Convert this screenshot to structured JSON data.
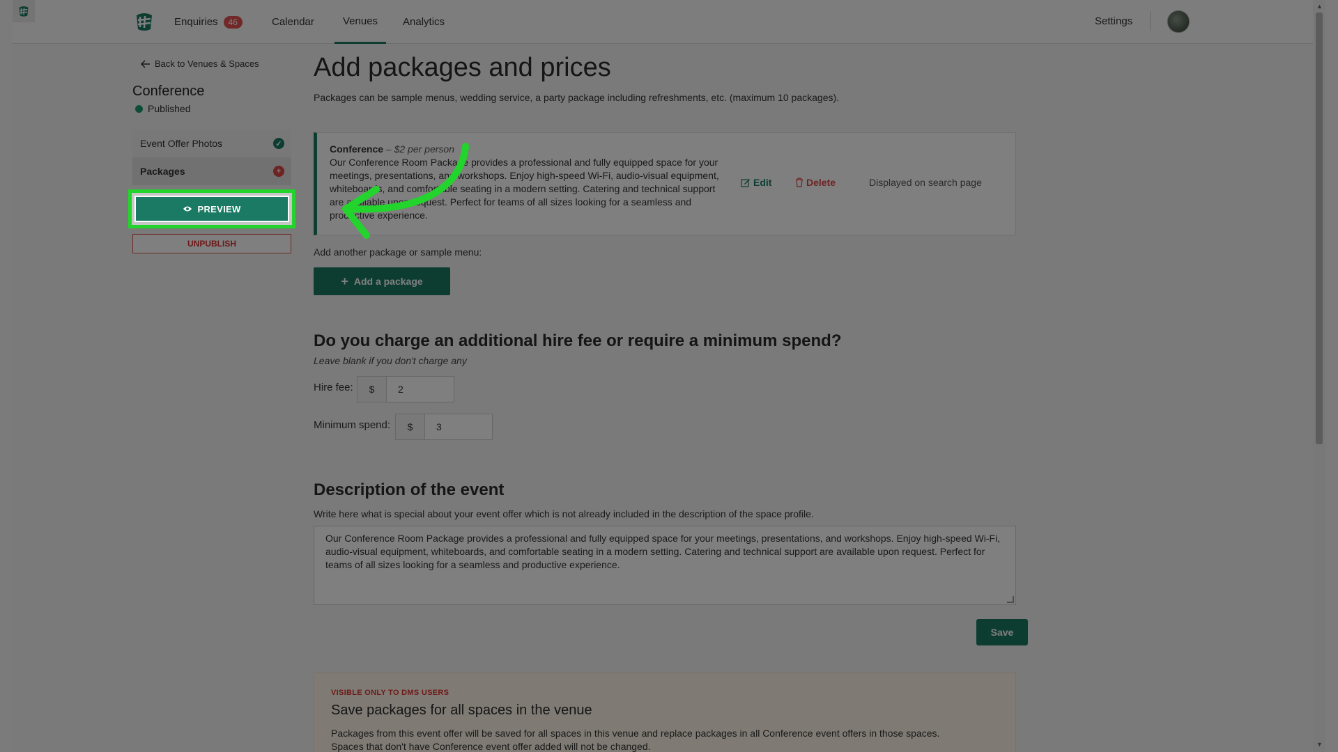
{
  "nav": {
    "enquiries_label": "Enquiries",
    "enquiries_count": "46",
    "calendar_label": "Calendar",
    "venues_label": "Venues",
    "analytics_label": "Analytics",
    "settings_label": "Settings"
  },
  "sidebar": {
    "back_label": "Back to Venues & Spaces",
    "space_title": "Conference",
    "status": "Published",
    "items": [
      {
        "label": "Event Offer Photos",
        "state": "complete"
      },
      {
        "label": "Packages",
        "state": "incomplete"
      }
    ],
    "preview_label": "PREVIEW",
    "unpublish_label": "UNPUBLISH"
  },
  "main": {
    "title": "Add packages and prices",
    "lead": "Packages can be sample menus, wedding service, a party package including refreshments, etc. (maximum 10 packages).",
    "package": {
      "name": "Conference",
      "price": " – $2 per person",
      "description": "Our Conference Room Package provides a professional and fully equipped space for your meetings, presentations, and workshops. Enjoy high-speed Wi-Fi, audio-visual equipment, whiteboards, and comfortable seating in a modern setting. Catering and technical support are available upon request. Perfect for teams of all sizes looking for a seamless and productive experience.",
      "edit_label": "Edit",
      "delete_label": "Delete",
      "displayed_label": "Displayed on search page"
    },
    "add_another_label": "Add another package or sample menu:",
    "add_button_label": "Add a package",
    "fees": {
      "heading": "Do you charge an additional hire fee or require a minimum spend?",
      "hint": "Leave blank if you don't charge any",
      "hire_fee_label": "Hire fee:",
      "hire_fee_prefix": "$",
      "hire_fee_value": "2",
      "min_spend_label": "Minimum spend:",
      "min_spend_prefix": "$",
      "min_spend_value": "3"
    },
    "description": {
      "heading": "Description of the event",
      "sub": "Write here what is special about your event offer which is not already included in the description of the space profile.",
      "text": "Our Conference Room Package provides a professional and fully equipped space for your meetings, presentations, and workshops. Enjoy high-speed Wi-Fi, audio-visual equipment, whiteboards, and comfortable seating in a modern setting. Catering and technical support are available upon request. Perfect for teams of all sizes looking for a seamless and productive experience."
    },
    "save_label": "Save",
    "dms": {
      "tag": "VISIBLE ONLY TO DMS USERS",
      "title": "Save packages for all spaces in the venue",
      "text1": "Packages from this event offer will be saved for all spaces in this venue and replace packages in all Conference event offers in those spaces.",
      "text2": "Spaces that don't have Conference event offer added will not be changed."
    }
  },
  "colors": {
    "brand": "#1b7a63",
    "danger": "#d44444",
    "highlight": "#22d42b"
  },
  "icons": [
    "logo-icon",
    "arrow-left-icon",
    "check-circle-icon",
    "plus-circle-icon",
    "eye-icon",
    "edit-icon",
    "trash-icon",
    "plus-icon",
    "annotation-arrow"
  ]
}
